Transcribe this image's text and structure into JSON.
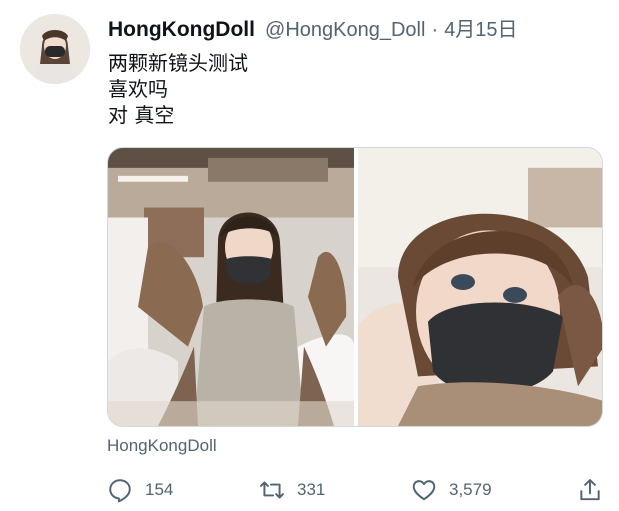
{
  "author": {
    "display_name": "HongKongDoll",
    "handle": "@HongKong_Doll",
    "separator": "·",
    "date": "4月15日"
  },
  "tweet": {
    "lines": [
      "两颗新镜头测试",
      "喜欢吗",
      "对 真空"
    ]
  },
  "media": {
    "image_count": 2,
    "watermark": "Twitter@HongKong_Doll"
  },
  "source_label": "HongKongDoll",
  "actions": {
    "reply": {
      "icon": "reply-icon",
      "count": "154"
    },
    "retweet": {
      "icon": "retweet-icon",
      "count": "331"
    },
    "like": {
      "icon": "heart-icon",
      "count": "3,579"
    },
    "share": {
      "icon": "share-icon"
    }
  },
  "colors": {
    "text_primary": "#0f1419",
    "text_secondary": "#536471",
    "border": "#cfd9de"
  }
}
